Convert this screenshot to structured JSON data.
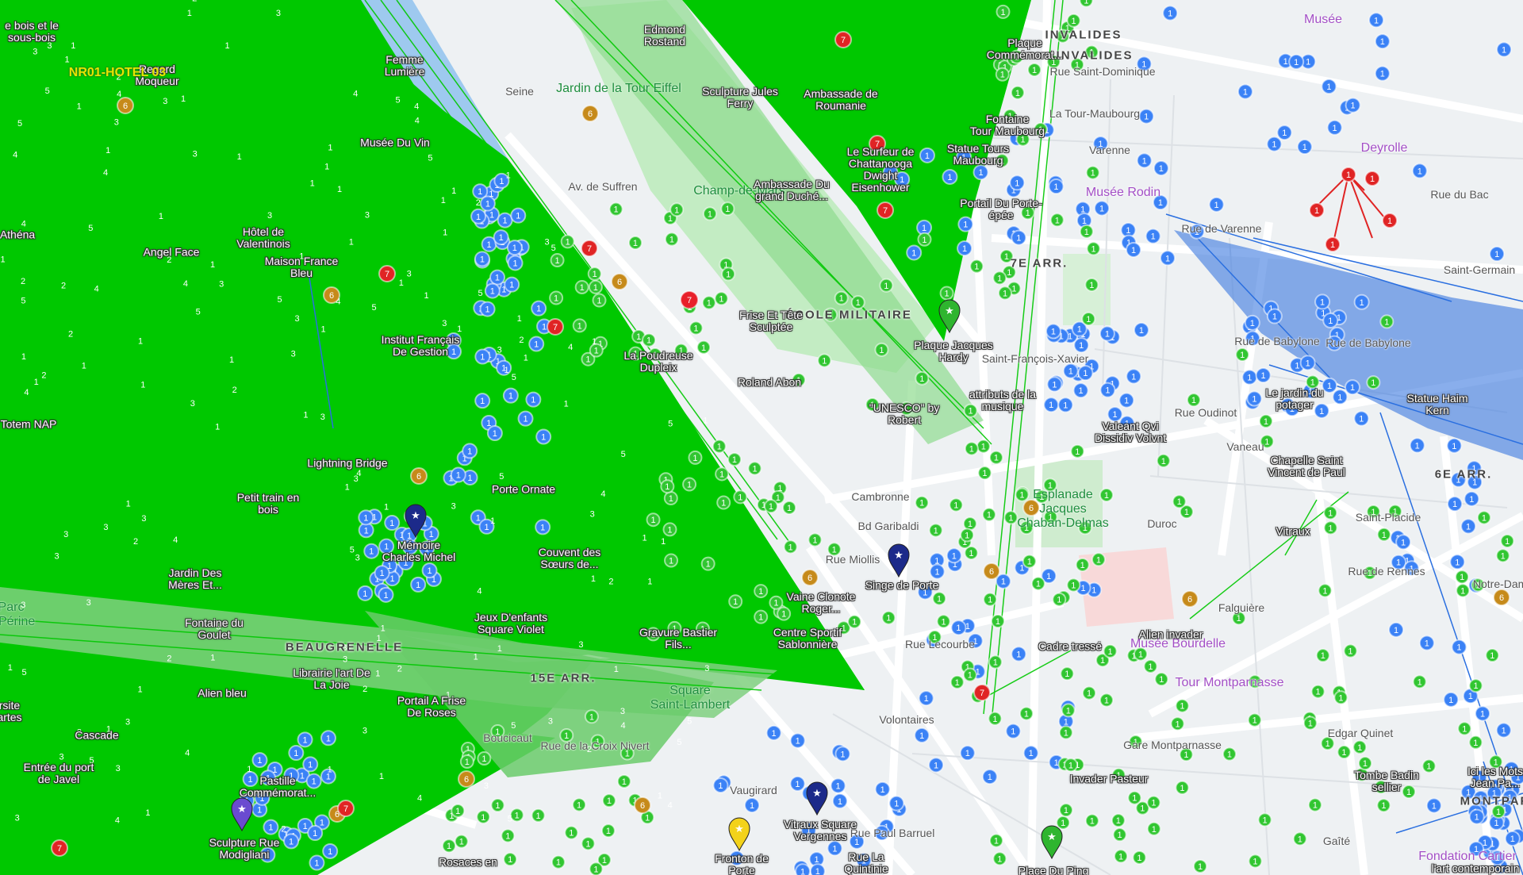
{
  "colors": {
    "zone_green": "#00c800",
    "zone_green_light": "#5fd35f",
    "zone_blue": "#3a78e0",
    "cluster_blue": "#3b82f6",
    "cluster_green": "#31c631",
    "cluster_orange": "#c68a1a",
    "cluster_red": "#e02424",
    "marker_red": "#e8202a"
  },
  "special_label": "NR01-HOTEL 03",
  "area_labels": [
    {
      "id": "invalides-1",
      "text": "INVALIDES"
    },
    {
      "id": "invalides-2",
      "text": "INVALIDES"
    },
    {
      "id": "ecole-militaire",
      "text": "ÉCOLE MILITAIRE"
    },
    {
      "id": "arr7",
      "text": "7E ARR."
    },
    {
      "id": "beaugrenelle",
      "text": "BEAUGRENELLE"
    },
    {
      "id": "arr15",
      "text": "15E ARR."
    },
    {
      "id": "arr6",
      "text": "6E ARR."
    },
    {
      "id": "montparnasse",
      "text": "MONTPAR"
    }
  ],
  "street_labels": [
    {
      "id": "seine",
      "text": "Seine"
    },
    {
      "id": "av-suffren",
      "text": "Av. de Suffren"
    },
    {
      "id": "rue-babylone",
      "text": "Rue de Babylone"
    },
    {
      "id": "rue-babylone-2",
      "text": "Rue de Babylone"
    },
    {
      "id": "rue-varenne",
      "text": "Rue de Varenne"
    },
    {
      "id": "rue-bac",
      "text": "Rue du Bac"
    },
    {
      "id": "rue-oudinot",
      "text": "Rue Oudinot"
    },
    {
      "id": "rue-lecourbe",
      "text": "Rue Lecourbe"
    },
    {
      "id": "rue-vaugirard",
      "text": "Vaugirard"
    },
    {
      "id": "rue-falguiere",
      "text": "Falguière"
    },
    {
      "id": "rue-rennes",
      "text": "Rue de Rennes"
    },
    {
      "id": "vaneau",
      "text": "Vaneau"
    },
    {
      "id": "volontaires",
      "text": "Volontaires"
    },
    {
      "id": "bd-garibaldi",
      "text": "Bd Garibaldi"
    },
    {
      "id": "cambronne",
      "text": "Cambronne"
    },
    {
      "id": "gare-montparnasse",
      "text": "Gare Montparnasse"
    },
    {
      "id": "edgar-quinet",
      "text": "Edgar Quinet"
    },
    {
      "id": "saint-placide",
      "text": "Saint-Placide"
    },
    {
      "id": "duroc",
      "text": "Duroc"
    },
    {
      "id": "notre-dame",
      "text": "Notre-Dame"
    },
    {
      "id": "gaite",
      "text": "Gaîté"
    },
    {
      "id": "saint-germain",
      "text": "Saint-Germain"
    },
    {
      "id": "rue-paul-barruel",
      "text": "Rue Paul Barruel"
    },
    {
      "id": "boucicaut",
      "text": "Boucicaut"
    },
    {
      "id": "rue-croix-nivert",
      "text": "Rue de la Croix Nivert"
    },
    {
      "id": "rue-miollis",
      "text": "Rue Miollis"
    },
    {
      "id": "saint-francois-xavier",
      "text": "Saint-François-Xavier"
    },
    {
      "id": "rue-saint-dominique",
      "text": "Rue Saint-Dominique"
    },
    {
      "id": "la-tour-maubourg",
      "text": "La Tour-Maubourg"
    },
    {
      "id": "varenne",
      "text": "Varenne"
    }
  ],
  "poi_labels": [
    {
      "id": "musee-rodin",
      "text": "Musée Rodin"
    },
    {
      "id": "musee-bourdelle",
      "text": "Musée Bourdelle"
    },
    {
      "id": "tour-montparnasse",
      "text": "Tour Montparnasse"
    },
    {
      "id": "fondation-cartier",
      "text": "Fondation Cartier"
    },
    {
      "id": "musee-top",
      "text": "Musée"
    },
    {
      "id": "deyrolle",
      "text": "Deyrolle"
    }
  ],
  "park_labels": [
    {
      "id": "champ-de-mars",
      "text": "Champ-de-Mars"
    },
    {
      "id": "jardin-tour-eiffel",
      "text": "Jardin de la Tour Eiffel"
    },
    {
      "id": "esplanade",
      "text": "Esplanade\nJacques\nChaban-Delmas"
    },
    {
      "id": "square-saint-lambert",
      "text": "Square\nSaint-Lambert"
    },
    {
      "id": "parc-andre",
      "text": "Parc\ne-Périne"
    }
  ],
  "place_labels": [
    {
      "id": "bois",
      "text": "e bois et le\nsous-bois"
    },
    {
      "id": "regard-moqueur",
      "text": "Regard\nMoqueur"
    },
    {
      "id": "femme-lumiere",
      "text": "Femme\nLumière"
    },
    {
      "id": "edmond-rostand",
      "text": "Edmond\nRostand"
    },
    {
      "id": "plaque-commemorat",
      "text": "Plaque\nCommémorat..."
    },
    {
      "id": "sculpture-jules-ferry",
      "text": "Sculpture Jules\nFerry"
    },
    {
      "id": "ambassade-roumanie",
      "text": "Ambassade de\nRoumanie"
    },
    {
      "id": "fontaine-tour-maubourg",
      "text": "Fontaine\nTour Maubourg"
    },
    {
      "id": "statue-tours-maubourg",
      "text": "Statue Tours\nMaubourg"
    },
    {
      "id": "musee-du-vin",
      "text": "Musée Du Vin"
    },
    {
      "id": "surfeur",
      "text": "Le Surfeur de\nChattanooga\nDwight\nEisenhower"
    },
    {
      "id": "ambassade-grand-duche",
      "text": "Ambassade Du\ngrand Duché..."
    },
    {
      "id": "portail-porte-epee",
      "text": "Portail Du Porte-\népée"
    },
    {
      "id": "athena",
      "text": "Athéna"
    },
    {
      "id": "hotel-valentinois",
      "text": "Hôtel de\nValentinois"
    },
    {
      "id": "angel-face",
      "text": "Angel Face"
    },
    {
      "id": "maison-france-bleu",
      "text": "Maison France\nBleu"
    },
    {
      "id": "institut-francais",
      "text": "Institut Français\nDe Gestion"
    },
    {
      "id": "frise-sculptee",
      "text": "Frise Et Tête\nSculptée"
    },
    {
      "id": "plaque-jacques-hardy",
      "text": "Plaque Jacques\nHardy"
    },
    {
      "id": "la-poudreuse",
      "text": "La Poudreuse\nDupleix"
    },
    {
      "id": "roland-abon",
      "text": "Roland Abon"
    },
    {
      "id": "attributs-musique",
      "text": "attributs de la\nmusique"
    },
    {
      "id": "jardin-potager",
      "text": "Le jardin du\npotager"
    },
    {
      "id": "statue-haim-kern",
      "text": "Statue Haim\nKern"
    },
    {
      "id": "totem-nap",
      "text": "Totem NAP"
    },
    {
      "id": "unesco",
      "text": "\"UNESCO\" by\nRobert"
    },
    {
      "id": "valeant",
      "text": "Valeant Qvi\nDissidiv Volvnt"
    },
    {
      "id": "lightning-bridge",
      "text": "Lightning Bridge"
    },
    {
      "id": "chapelle-saint-vincent",
      "text": "Chapelle Saint\nVincent de Paul"
    },
    {
      "id": "petit-train",
      "text": "Petit train en\nbois"
    },
    {
      "id": "porte-ornate",
      "text": "Porte Ornate"
    },
    {
      "id": "memoire-charles-michel",
      "text": "Mémoire\nCharles Michel"
    },
    {
      "id": "couvent-soeurs",
      "text": "Couvent des\nSœurs de..."
    },
    {
      "id": "singe-de-porte",
      "text": "Singe de Porte"
    },
    {
      "id": "vitraux",
      "text": "Vitraux"
    },
    {
      "id": "jardin-meres",
      "text": "Jardin Des\nMères Et..."
    },
    {
      "id": "vaine-clonote",
      "text": "Vaine Clonote\nRoger..."
    },
    {
      "id": "fontaine-goulet",
      "text": "Fontaine du\nGoulet"
    },
    {
      "id": "jeux-enfants",
      "text": "Jeux D'enfants\nSquare Violet"
    },
    {
      "id": "gravure-bastier",
      "text": "Gravure Bastier\nFils..."
    },
    {
      "id": "centre-sportif",
      "text": "Centre Sportif\nSablonnière"
    },
    {
      "id": "alien-invader",
      "text": "Alien invader"
    },
    {
      "id": "cadre-tresse",
      "text": "Cadre tressé"
    },
    {
      "id": "librairie",
      "text": "Librairie l'art De\nLa Joie"
    },
    {
      "id": "alien-bleu",
      "text": "Alien bleu"
    },
    {
      "id": "portail-frise",
      "text": "Portail A Frise\nDe Roses"
    },
    {
      "id": "rsite-artes",
      "text": "rsite\nartes"
    },
    {
      "id": "cascade",
      "text": "Cascade"
    },
    {
      "id": "invader-pasteur",
      "text": "Invader Pasteur"
    },
    {
      "id": "entree-port-javel",
      "text": "Entrée du port\nde Javel"
    },
    {
      "id": "pastille",
      "text": "Pastille\nCommémorat..."
    },
    {
      "id": "tombe-badin",
      "text": "Tombe Badin\nsellier"
    },
    {
      "id": "ici-les-mots",
      "text": "Ici les Mots\nJean Pa..."
    },
    {
      "id": "sculpture-modigliani",
      "text": "Sculpture Rue\nModigliani"
    },
    {
      "id": "vitraux-square",
      "text": "Vitraux Square\nVergennes"
    },
    {
      "id": "fronton",
      "text": "Fronton de\nPorte"
    },
    {
      "id": "rue-quintinie",
      "text": "Rue La\nQuintinie"
    },
    {
      "id": "rosaces",
      "text": "Rosaces en"
    },
    {
      "id": "place-du-ping",
      "text": "Place Du Ping"
    },
    {
      "id": "art-contemporain",
      "text": "l'art contemporain"
    }
  ],
  "markers": [
    {
      "id": "memoire",
      "type": "navy-star"
    },
    {
      "id": "singe",
      "type": "navy-star"
    },
    {
      "id": "vitraux-sq",
      "type": "navy-star"
    },
    {
      "id": "sculpture-modigliani",
      "type": "purple-star"
    },
    {
      "id": "fronton",
      "type": "yellow-star"
    },
    {
      "id": "plaque-hardy",
      "type": "green-star"
    },
    {
      "id": "place-ping",
      "type": "green-star"
    }
  ]
}
